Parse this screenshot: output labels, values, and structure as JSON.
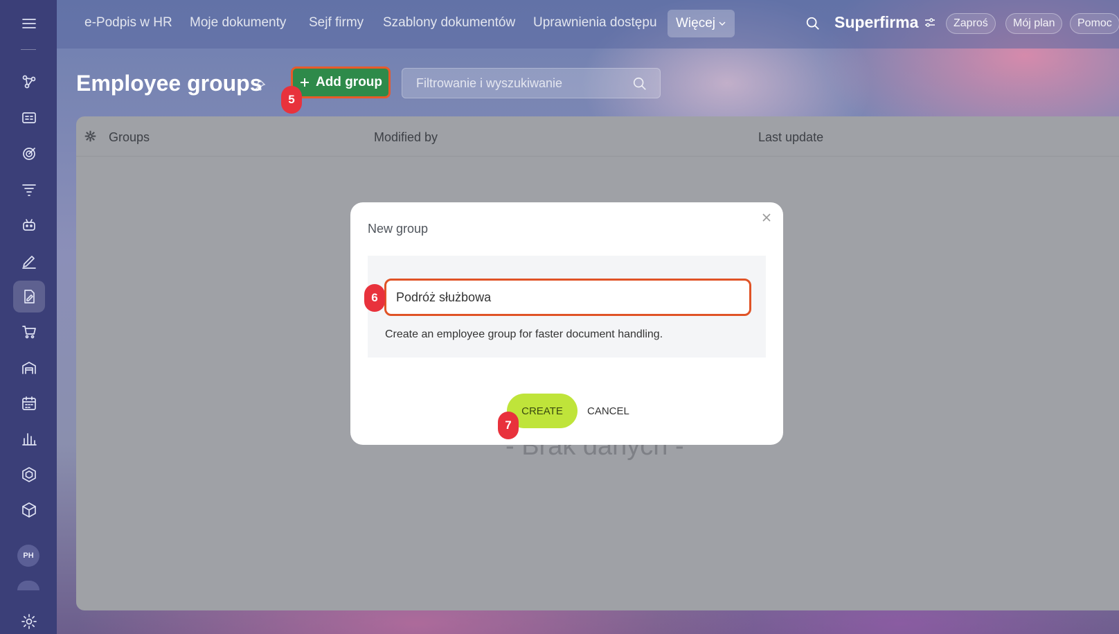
{
  "nav": {
    "items": [
      "e-Podpis w HR",
      "Moje dokumenty",
      "Sejf firmy",
      "Szablony dokumentów",
      "Uprawnienia dostępu"
    ],
    "more_label": "Więcej",
    "brand": "Superfirma",
    "pills": [
      "Zaproś",
      "Mój plan",
      "Pomoc"
    ]
  },
  "sidebar": {
    "avatar_initials": "PH"
  },
  "page": {
    "title": "Employee groups",
    "add_button": "Add group",
    "filter_placeholder": "Filtrowanie i wyszukiwanie"
  },
  "table": {
    "columns": [
      "Groups",
      "Modified by",
      "Last update"
    ],
    "empty_text": "- Brak danych -"
  },
  "modal": {
    "title": "New group",
    "input_value": "Podróż służbowa",
    "hint": "Create an employee group for faster document handling.",
    "create_label": "CREATE",
    "cancel_label": "CANCEL"
  },
  "badges": [
    "5",
    "6",
    "7"
  ],
  "colors": {
    "sidebar": "#3b3f78",
    "add_button": "#2e8a4a",
    "highlight_border": "#e05326",
    "create_button": "#bfe43a",
    "badge": "#e8323c"
  }
}
